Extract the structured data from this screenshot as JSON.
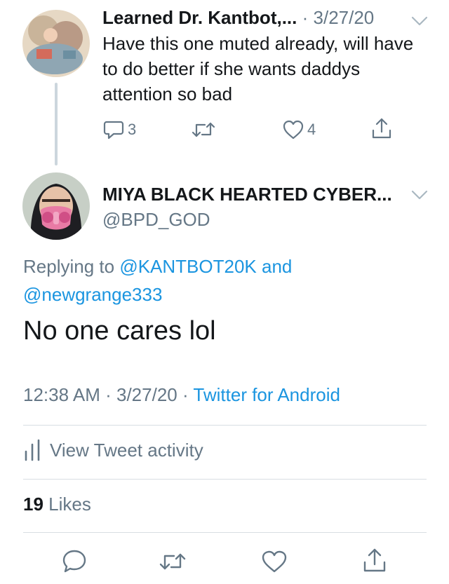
{
  "reply_tweet": {
    "display_name": "Learned Dr. Kantbot,...",
    "separator": "·",
    "date": "3/27/20",
    "text": "Have this one muted already, will have to do better if she wants daddys attention so bad",
    "reply_count": "3",
    "like_count": "4"
  },
  "main_tweet": {
    "display_name": "MIYA BLACK HEARTED CYBER...",
    "handle": "@BPD_GOD",
    "replying_prefix": "Replying to",
    "replying_user1": "@KANTBOT20K",
    "replying_and": "and",
    "replying_user2": "@newgrange333",
    "text": "No one cares lol",
    "time": "12:38 AM",
    "separator1": "·",
    "date": "3/27/20",
    "separator2": "·",
    "source": "Twitter for Android",
    "activity_label": "View Tweet activity",
    "likes_count": "19",
    "likes_label": "Likes"
  },
  "colors": {
    "accent_blue": "#1b95e0",
    "muted_gray": "#657786",
    "divider": "#d8dee3"
  },
  "icons": [
    "chevron-down-icon",
    "reply-icon",
    "retweet-icon",
    "like-icon",
    "share-icon",
    "activity-icon"
  ]
}
